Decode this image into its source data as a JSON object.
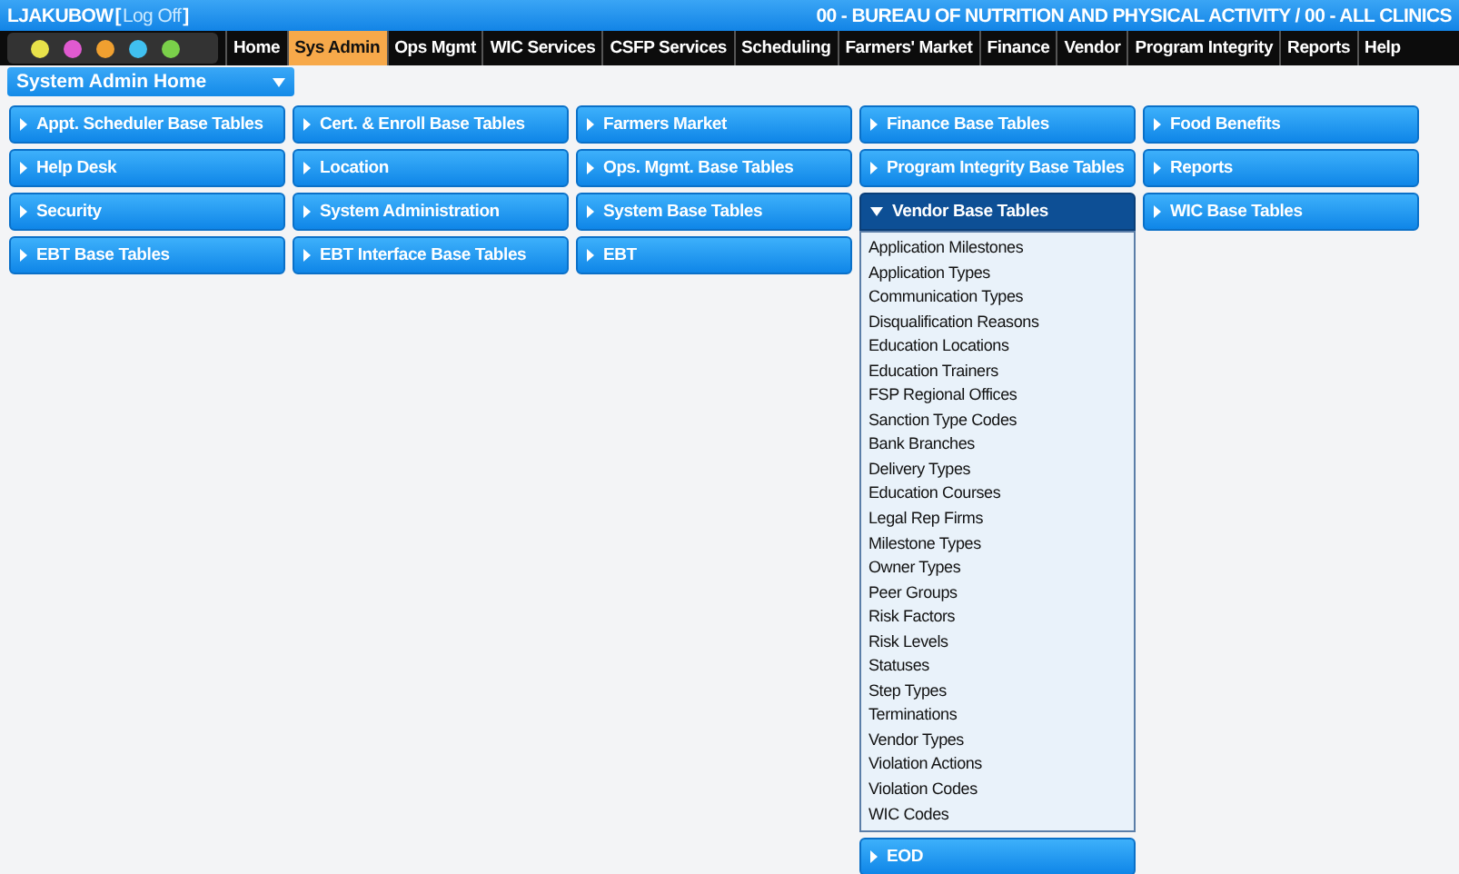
{
  "header": {
    "user": "LJAKUBOW",
    "bracket_open": "[",
    "logout_link": "Log Off",
    "bracket_close": "]",
    "organization": "00 - BUREAU OF NUTRITION AND PHYSICAL ACTIVITY / 00 - ALL CLINICS"
  },
  "nav": [
    {
      "label": "Home",
      "selected": false
    },
    {
      "label": "Sys Admin",
      "selected": true
    },
    {
      "label": "Ops Mgmt",
      "selected": false
    },
    {
      "label": "WIC Services",
      "selected": false
    },
    {
      "label": "CSFP Services",
      "selected": false
    },
    {
      "label": "Scheduling",
      "selected": false
    },
    {
      "label": "Farmers' Market",
      "selected": false
    },
    {
      "label": "Finance",
      "selected": false
    },
    {
      "label": "Vendor",
      "selected": false
    },
    {
      "label": "Program Integrity",
      "selected": false
    },
    {
      "label": "Reports",
      "selected": false
    },
    {
      "label": "Help",
      "selected": false
    }
  ],
  "page_dropdown": {
    "label": "System Admin Home"
  },
  "columns": [
    [
      {
        "label": "Appt. Scheduler Base Tables",
        "expanded": false
      },
      {
        "label": "Help Desk",
        "expanded": false
      },
      {
        "label": "Security",
        "expanded": false
      },
      {
        "label": "EBT Base Tables",
        "expanded": false
      }
    ],
    [
      {
        "label": "Cert. & Enroll Base Tables",
        "expanded": false
      },
      {
        "label": "Location",
        "expanded": false
      },
      {
        "label": "System Administration",
        "expanded": false
      },
      {
        "label": "EBT Interface Base Tables",
        "expanded": false
      }
    ],
    [
      {
        "label": "Farmers Market",
        "expanded": false
      },
      {
        "label": "Ops. Mgmt. Base Tables",
        "expanded": false
      },
      {
        "label": "System Base Tables",
        "expanded": false
      },
      {
        "label": "EBT",
        "expanded": false
      }
    ],
    [
      {
        "label": "Finance Base Tables",
        "expanded": false
      },
      {
        "label": "Program Integrity Base Tables",
        "expanded": false
      },
      {
        "label": "Vendor Base Tables",
        "expanded": true,
        "items": [
          "Application Milestones",
          "Application Types",
          "Communication Types",
          "Disqualification Reasons",
          "Education Locations",
          "Education Trainers",
          "FSP Regional Offices",
          "Sanction Type Codes",
          "Bank Branches",
          "Delivery Types",
          "Education Courses",
          "Legal Rep Firms",
          "Milestone Types",
          "Owner Types",
          "Peer Groups",
          "Risk Factors",
          "Risk Levels",
          "Statuses",
          "Step Types",
          "Terminations",
          "Vendor Types",
          "Violation Actions",
          "Violation Codes",
          "WIC Codes"
        ]
      },
      {
        "label": "EOD",
        "expanded": false
      }
    ],
    [
      {
        "label": "Food Benefits",
        "expanded": false
      },
      {
        "label": "Reports",
        "expanded": false
      },
      {
        "label": "WIC Base Tables",
        "expanded": false
      }
    ]
  ]
}
